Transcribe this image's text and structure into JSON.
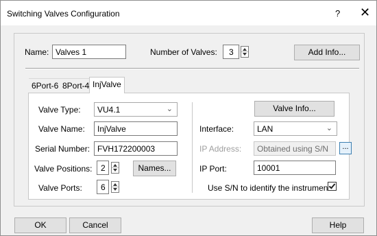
{
  "window": {
    "title": "Switching Valves Configuration",
    "help_symbol": "?",
    "close_symbol": "✕"
  },
  "top": {
    "name_label": "Name:",
    "name_value": "Valves 1",
    "num_valves_label": "Number of Valves:",
    "num_valves_value": "3",
    "add_info_button": "Add Info..."
  },
  "tabs": [
    {
      "label": "6Port-6",
      "active": false
    },
    {
      "label": "8Port-4",
      "active": false
    },
    {
      "label": "InjValve",
      "active": true
    }
  ],
  "left": {
    "valve_type_label": "Valve Type:",
    "valve_type_value": "VU4.1",
    "valve_name_label": "Valve Name:",
    "valve_name_value": "InjValve",
    "serial_label": "Serial Number:",
    "serial_value": "FVH172200003",
    "positions_label": "Valve Positions:",
    "positions_value": "2",
    "names_button": "Names...",
    "ports_label": "Valve Ports:",
    "ports_value": "6"
  },
  "right": {
    "valve_info_button": "Valve Info...",
    "interface_label": "Interface:",
    "interface_value": "LAN",
    "ip_address_label": "IP Address:",
    "ip_address_value": "Obtained using S/N",
    "ip_browse_button": "...",
    "ip_port_label": "IP Port:",
    "ip_port_value": "10001",
    "use_sn_label": "Use S/N to identify the instrument:",
    "use_sn_checked": true
  },
  "footer": {
    "ok_button": "OK",
    "cancel_button": "Cancel",
    "help_button": "Help"
  }
}
